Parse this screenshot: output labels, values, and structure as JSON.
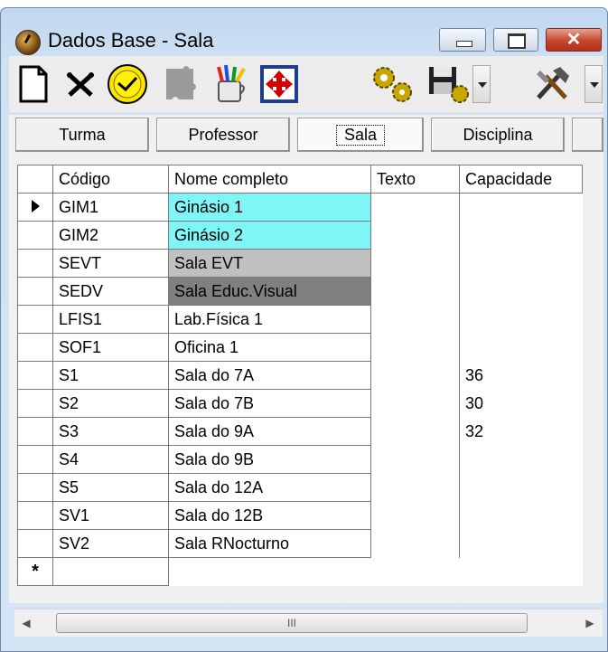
{
  "window": {
    "title": "Dados Base - Sala",
    "close_glyph": "✕"
  },
  "toolbar": {
    "icons": [
      "new-document-icon",
      "delete-icon",
      "clock-icon",
      "puzzle-icon",
      "paint-cup-icon",
      "move-arrows-icon",
      "gears-icon",
      "save-icon",
      "tools-icon"
    ]
  },
  "tabs": [
    {
      "label": "Turma"
    },
    {
      "label": "Professor"
    },
    {
      "label": "Sala",
      "active": true
    },
    {
      "label": "Disciplina"
    }
  ],
  "grid": {
    "columns": [
      "Código",
      "Nome completo",
      "Texto",
      "Capacidade"
    ],
    "rows": [
      {
        "code": "GIM1",
        "name": "Ginásio 1",
        "text": "",
        "capacity": "",
        "color": "#7ff5f8"
      },
      {
        "code": "GIM2",
        "name": "Ginásio 2",
        "text": "",
        "capacity": "",
        "color": "#7ff5f8"
      },
      {
        "code": "SEVT",
        "name": "Sala EVT",
        "text": "",
        "capacity": "",
        "color": "#c0c0c0"
      },
      {
        "code": "SEDV",
        "name": "Sala Educ.Visual",
        "text": "",
        "capacity": "",
        "color": "#808080"
      },
      {
        "code": "LFIS1",
        "name": "Lab.Física 1",
        "text": "",
        "capacity": "",
        "color": ""
      },
      {
        "code": "SOF1",
        "name": "Oficina 1",
        "text": "",
        "capacity": "",
        "color": ""
      },
      {
        "code": "S1",
        "name": "Sala do 7A",
        "text": "",
        "capacity": "36",
        "color": ""
      },
      {
        "code": "S2",
        "name": "Sala do 7B",
        "text": "",
        "capacity": "30",
        "color": ""
      },
      {
        "code": "S3",
        "name": "Sala do 9A",
        "text": "",
        "capacity": "32",
        "color": ""
      },
      {
        "code": "S4",
        "name": "Sala do 9B",
        "text": "",
        "capacity": "",
        "color": ""
      },
      {
        "code": "S5",
        "name": "Sala do 12A",
        "text": "",
        "capacity": "",
        "color": ""
      },
      {
        "code": "SV1",
        "name": "Sala do 12B",
        "text": "",
        "capacity": "",
        "color": ""
      },
      {
        "code": "SV2",
        "name": "Sala RNocturno",
        "text": "",
        "capacity": "",
        "color": ""
      }
    ],
    "new_row_marker": "*"
  },
  "scrollbar": {
    "grip": "III",
    "left_arrow": "◀",
    "right_arrow": "▶"
  }
}
